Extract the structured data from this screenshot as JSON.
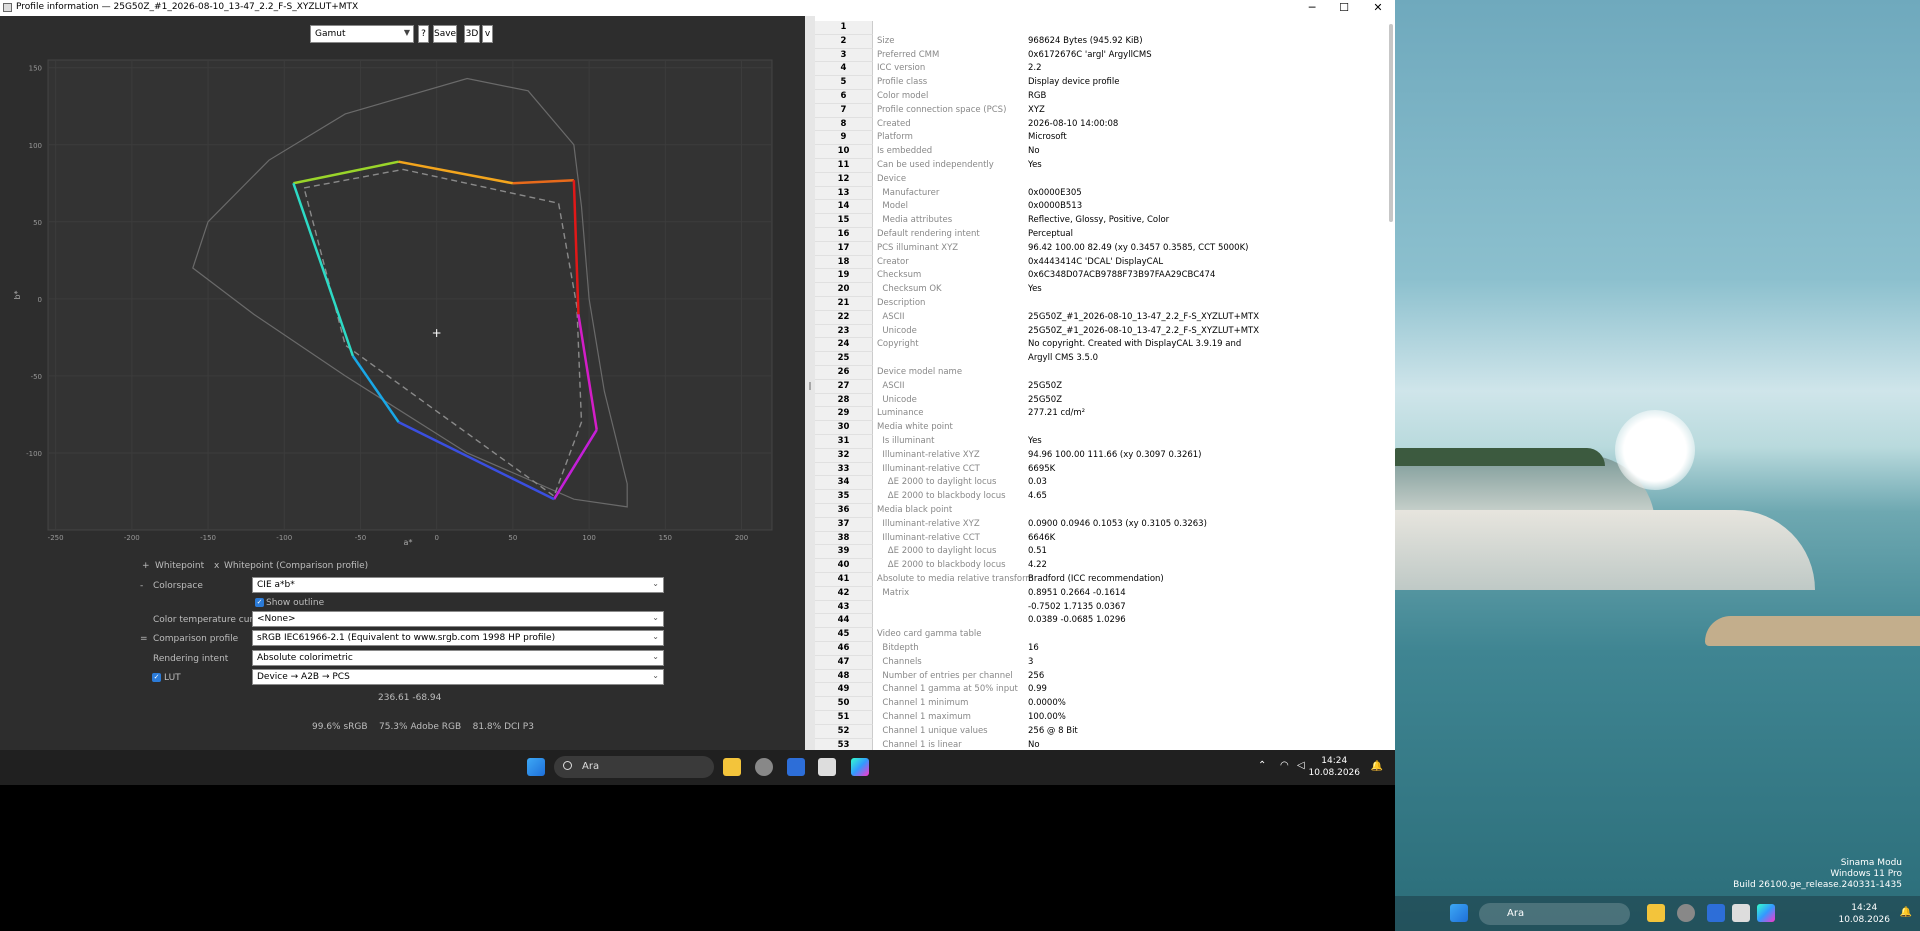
{
  "window": {
    "title": "Profile information — 25G50Z_#1_2026-08-10_13-47_2.2_F-S_XYZLUT+MTX",
    "minimize": "─",
    "maximize": "☐",
    "close": "✕"
  },
  "toolbar": {
    "view_select": "Gamut",
    "help": "?",
    "save": "Save",
    "threed": "3D",
    "v": "v"
  },
  "plot": {
    "xlabel": "a*",
    "ylabel": "b*",
    "xticks": [
      "-250",
      "-200",
      "-150",
      "-100",
      "-50",
      "0",
      "50",
      "100",
      "150",
      "200"
    ],
    "yticks": [
      "150",
      "100",
      "50",
      "0",
      "-50",
      "-100"
    ]
  },
  "chart_data": {
    "type": "scatter",
    "xlabel": "a*",
    "ylabel": "b*",
    "xlim": [
      -250,
      220
    ],
    "ylim": [
      -150,
      155
    ],
    "grid": true,
    "series": [
      {
        "values": [
          [
            -94,
            75
          ],
          [
            -25,
            89
          ],
          [
            50,
            75
          ],
          [
            90,
            77
          ],
          [
            93,
            -10
          ],
          [
            105,
            -85
          ],
          [
            77,
            -130
          ],
          [
            -25,
            -80
          ],
          [
            -55,
            -37
          ],
          [
            -94,
            75
          ]
        ]
      },
      {
        "values": [
          [
            -87,
            72
          ],
          [
            -22,
            84
          ],
          [
            80,
            62
          ],
          [
            92,
            -5
          ],
          [
            95,
            -80
          ],
          [
            77,
            -128
          ],
          [
            -60,
            -30
          ],
          [
            -87,
            72
          ]
        ]
      },
      {
        "values": [
          [
            -160,
            20
          ],
          [
            -150,
            50
          ],
          [
            -110,
            90
          ],
          [
            -60,
            120
          ],
          [
            20,
            143
          ],
          [
            60,
            135
          ],
          [
            90,
            100
          ],
          [
            95,
            60
          ],
          [
            100,
            0
          ],
          [
            110,
            -60
          ],
          [
            125,
            -120
          ],
          [
            125,
            -135
          ],
          [
            90,
            -130
          ],
          [
            20,
            -100
          ],
          [
            -60,
            -50
          ],
          [
            -120,
            -10
          ],
          [
            -160,
            20
          ]
        ]
      }
    ],
    "marker": [
      0,
      -22
    ]
  },
  "legend": {
    "whitepoint_marker": "+",
    "whitepoint": "Whitepoint",
    "comparison_marker": "x",
    "comparison": "Whitepoint (Comparison profile)"
  },
  "controls": {
    "colorspace_label": "Colorspace",
    "colorspace": "CIE a*b*",
    "show_outline": "Show outline",
    "ctc_label": "Color temperature curve",
    "ctc": "<None>",
    "comparison_label": "Comparison profile",
    "comparison": "sRGB IEC61966-2.1 (Equivalent to www.srgb.com 1998 HP profile)",
    "intent_label": "Rendering intent",
    "intent": "Absolute colorimetric",
    "lut_label": "LUT",
    "lut": "Device → A2B → PCS",
    "coords": "236.61 -68.94",
    "coverage": "99.6% sRGB    75.3% Adobe RGB    81.8% DCI P3",
    "minus": "-",
    "equals": "="
  },
  "rows": [
    {
      "n": "1",
      "k": "",
      "v": ""
    },
    {
      "n": "2",
      "k": "Size",
      "v": "968624 Bytes (945.92 KiB)"
    },
    {
      "n": "3",
      "k": "Preferred CMM",
      "v": "0x6172676C 'argl' ArgyllCMS"
    },
    {
      "n": "4",
      "k": "ICC version",
      "v": "2.2"
    },
    {
      "n": "5",
      "k": "Profile class",
      "v": "Display device profile"
    },
    {
      "n": "6",
      "k": "Color model",
      "v": "RGB"
    },
    {
      "n": "7",
      "k": "Profile connection space (PCS)",
      "v": "XYZ"
    },
    {
      "n": "8",
      "k": "Created",
      "v": "2026-08-10 14:00:08"
    },
    {
      "n": "9",
      "k": "Platform",
      "v": "Microsoft"
    },
    {
      "n": "10",
      "k": "Is embedded",
      "v": "No"
    },
    {
      "n": "11",
      "k": "Can be used independently",
      "v": "Yes"
    },
    {
      "n": "12",
      "k": "Device",
      "v": ""
    },
    {
      "n": "13",
      "k": "  Manufacturer",
      "v": "0x0000E305"
    },
    {
      "n": "14",
      "k": "  Model",
      "v": "0x0000B513"
    },
    {
      "n": "15",
      "k": "  Media attributes",
      "v": "Reflective, Glossy, Positive, Color"
    },
    {
      "n": "16",
      "k": "Default rendering intent",
      "v": "Perceptual"
    },
    {
      "n": "17",
      "k": "PCS illuminant XYZ",
      "v": "96.42 100.00  82.49 (xy 0.3457 0.3585, CCT 5000K)"
    },
    {
      "n": "18",
      "k": "Creator",
      "v": "0x4443414C 'DCAL' DisplayCAL"
    },
    {
      "n": "19",
      "k": "Checksum",
      "v": "0x6C348D07ACB9788F73B97FAA29CBC474"
    },
    {
      "n": "20",
      "k": "  Checksum OK",
      "v": "Yes"
    },
    {
      "n": "21",
      "k": "Description",
      "v": ""
    },
    {
      "n": "22",
      "k": "  ASCII",
      "v": "25G50Z_#1_2026-08-10_13-47_2.2_F-S_XYZLUT+MTX"
    },
    {
      "n": "23",
      "k": "  Unicode",
      "v": "25G50Z_#1_2026-08-10_13-47_2.2_F-S_XYZLUT+MTX"
    },
    {
      "n": "24",
      "k": "Copyright",
      "v": "No copyright. Created with DisplayCAL 3.9.19 and"
    },
    {
      "n": "25",
      "k": "",
      "v": "Argyll CMS 3.5.0"
    },
    {
      "n": "26",
      "k": "Device model name",
      "v": ""
    },
    {
      "n": "27",
      "k": "  ASCII",
      "v": "25G50Z"
    },
    {
      "n": "28",
      "k": "  Unicode",
      "v": "25G50Z"
    },
    {
      "n": "29",
      "k": "Luminance",
      "v": "277.21 cd/m²"
    },
    {
      "n": "30",
      "k": "Media white point",
      "v": ""
    },
    {
      "n": "31",
      "k": "  Is illuminant",
      "v": "Yes"
    },
    {
      "n": "32",
      "k": "  Illuminant-relative XYZ",
      "v": "94.96 100.00 111.66 (xy 0.3097 0.3261)"
    },
    {
      "n": "33",
      "k": "  Illuminant-relative CCT",
      "v": "6695K"
    },
    {
      "n": "34",
      "k": "    ΔE 2000 to daylight locus",
      "v": "0.03"
    },
    {
      "n": "35",
      "k": "    ΔE 2000 to blackbody locus",
      "v": "4.65"
    },
    {
      "n": "36",
      "k": "Media black point",
      "v": ""
    },
    {
      "n": "37",
      "k": "  Illuminant-relative XYZ",
      "v": "0.0900 0.0946 0.1053 (xy 0.3105 0.3263)"
    },
    {
      "n": "38",
      "k": "  Illuminant-relative CCT",
      "v": "6646K"
    },
    {
      "n": "39",
      "k": "    ΔE 2000 to daylight locus",
      "v": "0.51"
    },
    {
      "n": "40",
      "k": "    ΔE 2000 to blackbody locus",
      "v": "4.22"
    },
    {
      "n": "41",
      "k": "Absolute to media relative transform",
      "v": "Bradford (ICC recommendation)"
    },
    {
      "n": "42",
      "k": "  Matrix",
      "v": "0.8951 0.2664 -0.1614"
    },
    {
      "n": "43",
      "k": "",
      "v": "-0.7502 1.7135 0.0367"
    },
    {
      "n": "44",
      "k": "",
      "v": "0.0389 -0.0685 1.0296"
    },
    {
      "n": "45",
      "k": "Video card gamma table",
      "v": ""
    },
    {
      "n": "46",
      "k": "  Bitdepth",
      "v": "16"
    },
    {
      "n": "47",
      "k": "  Channels",
      "v": "3"
    },
    {
      "n": "48",
      "k": "  Number of entries per channel",
      "v": "256"
    },
    {
      "n": "49",
      "k": "  Channel 1 gamma at 50% input",
      "v": "0.99"
    },
    {
      "n": "50",
      "k": "  Channel 1 minimum",
      "v": "0.0000%"
    },
    {
      "n": "51",
      "k": "  Channel 1 maximum",
      "v": "100.00%"
    },
    {
      "n": "52",
      "k": "  Channel 1 unique values",
      "v": "256 @ 8 Bit"
    },
    {
      "n": "53",
      "k": "  Channel 1 is linear",
      "v": "No"
    }
  ],
  "taskbar": {
    "search": "Ara",
    "time": "14:24",
    "date": "10.08.2026"
  },
  "desktop": {
    "watermark1": "Sinama Modu",
    "watermark2": "Windows 11 Pro",
    "watermark3": "Build 26100.ge_release.240331-1435",
    "search": "Ara",
    "time": "14:24",
    "date": "10.08.2026"
  }
}
